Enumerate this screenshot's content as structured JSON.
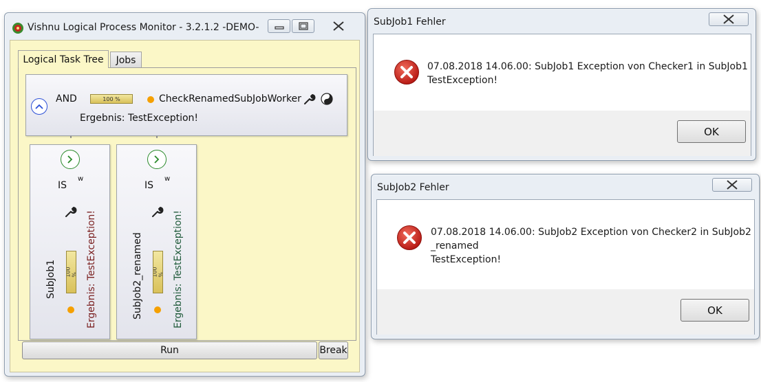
{
  "main_window": {
    "title": "Vishnu Logical Process Monitor - 3.2.1.2  -DEMO-",
    "tabs": [
      {
        "label": "Logical Task Tree",
        "active": true
      },
      {
        "label": "Jobs",
        "active": false
      }
    ],
    "root_node": {
      "operator": "AND",
      "progress": 1.0,
      "progress_label": "100 %",
      "name": "CheckRenamedSubJobWorker",
      "result": "Ergebnis: TestException!",
      "status_color": "#f5a000"
    },
    "child_nodes": [
      {
        "type": "IS",
        "marker": "w",
        "name": "SubJob1",
        "progress": 1.0,
        "progress_label": "100 %",
        "result": "Ergebnis: TestException!",
        "result_color": "#7a1f1f"
      },
      {
        "type": "IS",
        "marker": "w",
        "name": "SubJob2_renamed",
        "progress": 1.0,
        "progress_label": "100 %",
        "result": "Ergebnis: TestException!",
        "result_color": "#1f5a3a"
      }
    ],
    "buttons": {
      "run": "Run",
      "break": "Break"
    }
  },
  "dialog1": {
    "title": "SubJob1 Fehler",
    "message_line1": "07.08.2018 14.06.00: SubJob1 Exception von Checker1 in SubJob1",
    "message_line2": "TestException!",
    "ok": "OK"
  },
  "dialog2": {
    "title": "SubJob2 Fehler",
    "message_line1": "07.08.2018 14.06.00: SubJob2 Exception von Checker2 in SubJob2",
    "message_line2": "_renamed",
    "message_line3": "TestException!",
    "ok": "OK"
  },
  "icons": {
    "app": "vishnu-app-icon",
    "error": "error-icon",
    "tool": "wrench-icon",
    "yinyang": "yin-yang-icon"
  },
  "colors": {
    "panel_bg": "#fbf7c7",
    "accent_blue": "#2b4fd6",
    "expand_green": "#2a8a2a",
    "error_red": "#d22222"
  }
}
